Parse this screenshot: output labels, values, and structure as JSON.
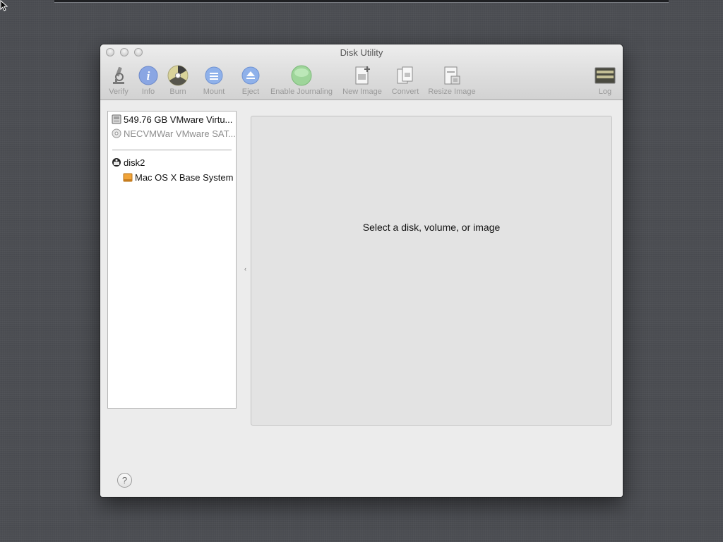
{
  "window": {
    "title": "Disk Utility"
  },
  "toolbar": {
    "verify": "Verify",
    "info": "Info",
    "burn": "Burn",
    "mount": "Mount",
    "eject": "Eject",
    "enable_journaling": "Enable Journaling",
    "new_image": "New Image",
    "convert": "Convert",
    "resize_image": "Resize Image",
    "log": "Log"
  },
  "sidebar": {
    "items": [
      {
        "label": "549.76 GB VMware Virtu...",
        "icon": "hard-disk-icon"
      },
      {
        "label": "NECVMWar VMware SAT...",
        "icon": "optical-drive-icon"
      },
      {
        "label": "disk2",
        "icon": "disk-image-icon"
      },
      {
        "label": "Mac OS X Base System",
        "icon": "volume-icon"
      }
    ]
  },
  "detail": {
    "message": "Select a disk, volume, or image"
  },
  "help": {
    "label": "?"
  }
}
